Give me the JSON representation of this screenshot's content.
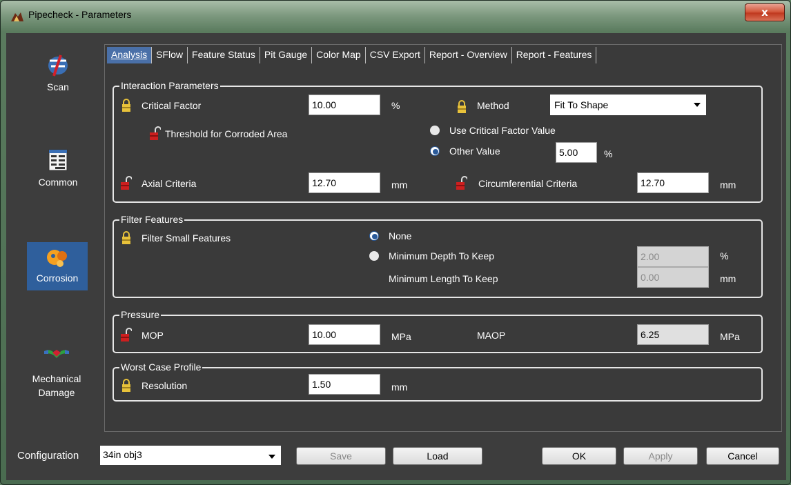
{
  "window": {
    "title": "Pipecheck - Parameters",
    "close_label": "x"
  },
  "sidebar": {
    "items": [
      {
        "label": "Scan",
        "icon": "scan-icon",
        "selected": false
      },
      {
        "label": "Common",
        "icon": "common-icon",
        "selected": false
      },
      {
        "label": "Corrosion",
        "icon": "corrosion-icon",
        "selected": true
      },
      {
        "label": "Mechanical Damage",
        "icon": "mechanical-damage-icon",
        "selected": false
      }
    ]
  },
  "tabs": [
    "Analysis",
    "SFlow",
    "Feature Status",
    "Pit Gauge",
    "Color Map",
    "CSV Export",
    "Report - Overview",
    "Report - Features"
  ],
  "interaction": {
    "title": "Interaction Parameters",
    "critical_factor_label": "Critical Factor",
    "critical_factor_value": "10.00",
    "critical_factor_unit": "%",
    "method_label": "Method",
    "method_value": "Fit To Shape",
    "threshold_label": "Threshold for Corroded Area",
    "use_critical_label": "Use Critical Factor Value",
    "other_value_label": "Other Value",
    "other_value": "5.00",
    "other_unit": "%",
    "axial_label": "Axial Criteria",
    "axial_value": "12.70",
    "axial_unit": "mm",
    "circ_label": "Circumferential Criteria",
    "circ_value": "12.70",
    "circ_unit": "mm"
  },
  "filter": {
    "title": "Filter Features",
    "small_label": "Filter Small Features",
    "none_label": "None",
    "min_depth_label": "Minimum Depth To Keep",
    "min_depth_value": "2.00",
    "min_depth_unit": "%",
    "min_length_label": "Minimum Length To Keep",
    "min_length_value": "0.00",
    "min_length_unit": "mm"
  },
  "pressure": {
    "title": "Pressure",
    "mop_label": "MOP",
    "mop_value": "10.00",
    "mop_unit": "MPa",
    "maop_label": "MAOP",
    "maop_value": "6.25",
    "maop_unit": "MPa"
  },
  "worst": {
    "title": "Worst Case Profile",
    "resolution_label": "Resolution",
    "resolution_value": "1.50",
    "resolution_unit": "mm"
  },
  "bottom": {
    "config_label": "Configuration",
    "config_value": "34in obj3",
    "save": "Save",
    "load": "Load",
    "ok": "OK",
    "apply": "Apply",
    "cancel": "Cancel"
  },
  "colors": {
    "selected": "#2f5f9c",
    "lock_gold": "#e8c23a",
    "lock_red": "#cc1f1f",
    "client_bg": "#3d3d3d"
  }
}
